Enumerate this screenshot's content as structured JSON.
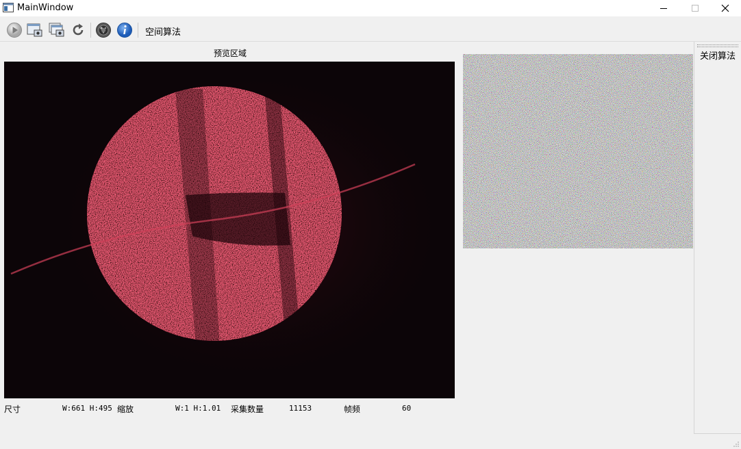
{
  "window": {
    "title": "MainWindow",
    "icon": "app-window-icon"
  },
  "window_buttons": {
    "minimize": "─",
    "maximize": "☐",
    "close": "✕"
  },
  "toolbar": {
    "buttons": [
      {
        "icon": "play-icon"
      },
      {
        "icon": "capture-screen-icon"
      },
      {
        "icon": "capture-multi-icon"
      },
      {
        "icon": "refresh-icon"
      },
      {
        "icon": "camera-lens-icon"
      },
      {
        "icon": "info-icon"
      }
    ],
    "algo_label": "空间算法"
  },
  "preview": {
    "label": "预览区域"
  },
  "side_panel": {
    "close_algo_label": "关闭算法"
  },
  "status": {
    "size_label": "尺寸",
    "size_value": "W:661 H:495",
    "zoom_label": "缩放",
    "zoom_value": "W:1 H:1.01",
    "count_label": "采集数量",
    "count_value": "11153",
    "fps_label": "帧频",
    "fps_value": "60"
  },
  "colors": {
    "preview_bg": "#0c0508",
    "speckle_red": "#c8283c",
    "toolbar_bg": "#f0f0f0",
    "info_blue": "#2a6fd1"
  }
}
